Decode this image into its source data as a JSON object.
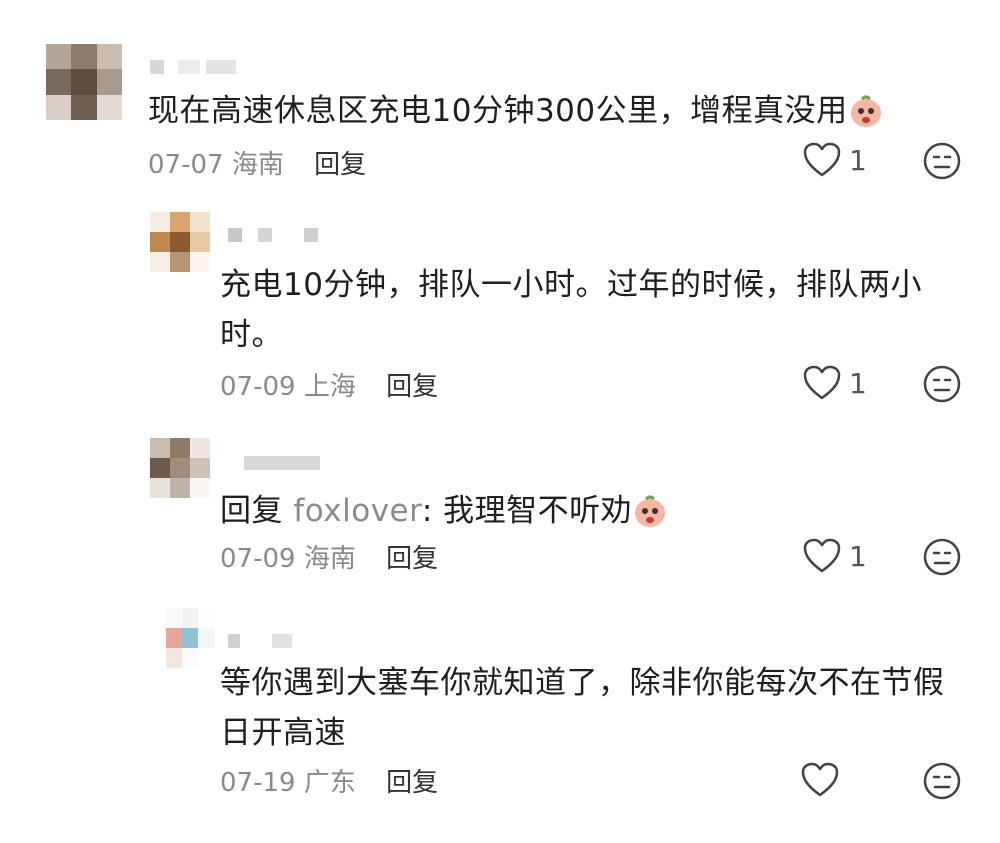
{
  "comments": [
    {
      "text": "现在高速休息区充电10分钟300公里，增程真没用",
      "date": "07-07",
      "location": "海南",
      "reply_label": "回复",
      "likes": "1"
    },
    {
      "text": "充电10分钟，排队一小时。过年的时候，排队两小时。",
      "date": "07-09",
      "location": "上海",
      "reply_label": "回复",
      "likes": "1"
    },
    {
      "reply_prefix": "回复",
      "mention": "foxlover",
      "text": ": 我理智不听劝",
      "date": "07-09",
      "location": "海南",
      "reply_label": "回复",
      "likes": "1"
    },
    {
      "text": "等你遇到大塞车你就知道了，除非你能每次不在节假日开高速",
      "date": "07-19",
      "location": "广东",
      "reply_label": "回复",
      "likes": ""
    }
  ],
  "icons": {
    "like": "heart-outline-icon",
    "dislike": "neutral-face-icon",
    "emoji": "peach-face-emoji"
  },
  "colors": {
    "text": "#1f1f1f",
    "meta": "#8a8a8a",
    "mention": "#8c8c8c",
    "icon": "#444444"
  }
}
